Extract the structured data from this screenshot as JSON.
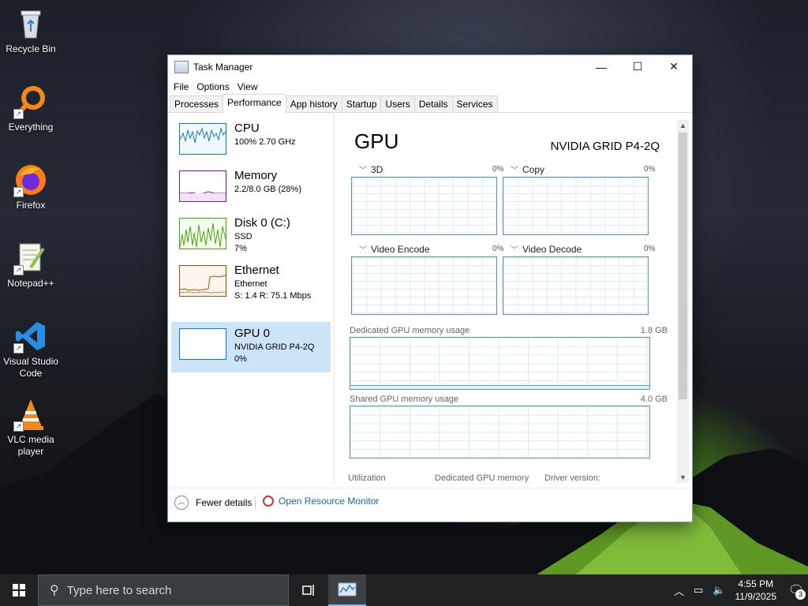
{
  "desktop": {
    "icons": [
      {
        "label": "Recycle Bin",
        "icon": "recycle-bin-icon"
      },
      {
        "label": "Everything",
        "icon": "everything-search-icon"
      },
      {
        "label": "Firefox",
        "icon": "firefox-icon"
      },
      {
        "label": "Notepad++",
        "icon": "notepad-plus-plus-icon"
      },
      {
        "label": "Visual Studio Code",
        "icon": "vscode-icon"
      },
      {
        "label": "VLC media player",
        "icon": "vlc-icon"
      }
    ]
  },
  "window": {
    "title": "Task Manager",
    "controls": {
      "minimize": "—",
      "maximize": "☐",
      "close": "✕"
    },
    "menu": [
      "File",
      "Options",
      "View"
    ],
    "tabs": [
      "Processes",
      "Performance",
      "App history",
      "Startup",
      "Users",
      "Details",
      "Services"
    ],
    "active_tab": "Performance"
  },
  "resources": [
    {
      "name": "CPU",
      "line1": "100%  2.70 GHz",
      "line2": "",
      "color": "#1179c1"
    },
    {
      "name": "Memory",
      "line1": "2.2/8.0 GB (28%)",
      "line2": "",
      "color": "#8b12ae"
    },
    {
      "name": "Disk 0 (C:)",
      "line1": "SSD",
      "line2": "7%",
      "color": "#4da60c"
    },
    {
      "name": "Ethernet",
      "line1": "Ethernet",
      "line2": "S: 1.4  R: 75.1 Mbps",
      "color": "#a74f01"
    },
    {
      "name": "GPU 0",
      "line1": "NVIDIA GRID P4-2Q",
      "line2": "0%",
      "color": "#1179c1",
      "selected": true
    }
  ],
  "gpu": {
    "title": "GPU",
    "model": "NVIDIA GRID P4-2Q",
    "engines": [
      {
        "label": "3D",
        "pct": "0%"
      },
      {
        "label": "Copy",
        "pct": "0%"
      },
      {
        "label": "Video Encode",
        "pct": "0%"
      },
      {
        "label": "Video Decode",
        "pct": "0%"
      }
    ],
    "dedicated_label": "Dedicated GPU memory usage",
    "dedicated_max": "1.8 GB",
    "shared_label": "Shared GPU memory usage",
    "shared_max": "4.0 GB",
    "stats_labels": [
      "Utilization",
      "Dedicated GPU memory",
      "Driver version:"
    ]
  },
  "footer": {
    "fewer_details": "Fewer details",
    "open_resource_monitor": "Open Resource Monitor"
  },
  "taskbar": {
    "search_placeholder": "Type here to search",
    "time": "4:55 PM",
    "date": "11/9/2025",
    "notifications": "3"
  }
}
